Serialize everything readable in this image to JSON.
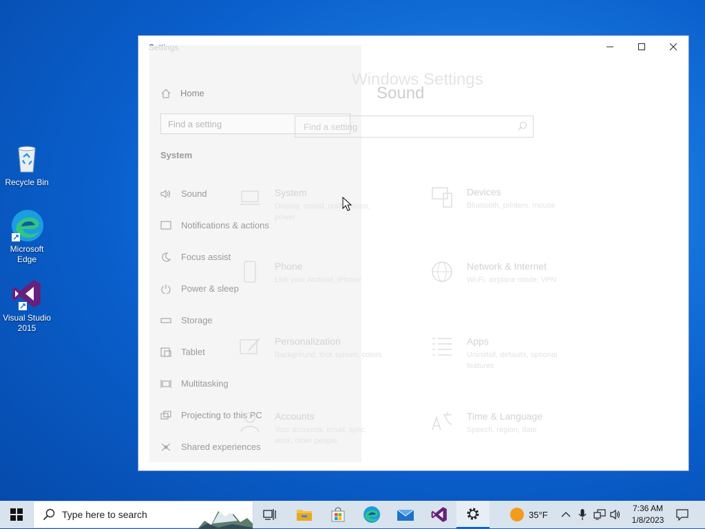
{
  "desktop": {
    "icons": [
      {
        "label": "Recycle Bin"
      },
      {
        "label": "Microsoft Edge"
      },
      {
        "label": "Visual Studio 2015"
      }
    ]
  },
  "window": {
    "title": "Settings",
    "controls": {
      "minimize": "minimize-icon",
      "maximize": "maximize-icon",
      "close": "close-icon"
    }
  },
  "nav": {
    "home": "Home",
    "search_placeholder": "Find a setting",
    "section": "System",
    "items": [
      {
        "label": "Sound",
        "icon": "speaker-icon"
      },
      {
        "label": "Notifications & actions",
        "icon": "notification-icon"
      },
      {
        "label": "Focus assist",
        "icon": "moon-icon"
      },
      {
        "label": "Power & sleep",
        "icon": "power-icon"
      },
      {
        "label": "Storage",
        "icon": "storage-icon"
      },
      {
        "label": "Tablet",
        "icon": "tablet-icon"
      },
      {
        "label": "Multitasking",
        "icon": "multitasking-icon"
      },
      {
        "label": "Projecting to this PC",
        "icon": "projecting-icon"
      },
      {
        "label": "Shared experiences",
        "icon": "shared-icon"
      }
    ]
  },
  "overlay": {
    "windows_settings_title": "Windows Settings",
    "sound_title": "Sound",
    "search_placeholder": "Find a setting",
    "tiles": [
      {
        "name": "System",
        "desc": "Display, sound, notifications, power",
        "icon": "laptop-icon"
      },
      {
        "name": "Devices",
        "desc": "Bluetooth, printers, mouse",
        "icon": "devices-icon"
      },
      {
        "name": "Phone",
        "desc": "Link your Android, iPhone",
        "icon": "phone-icon"
      },
      {
        "name": "Network & Internet",
        "desc": "Wi-Fi, airplane mode, VPN",
        "icon": "globe-icon"
      },
      {
        "name": "Personalization",
        "desc": "Background, lock screen, colors",
        "icon": "personalization-icon"
      },
      {
        "name": "Apps",
        "desc": "Uninstall, defaults, optional features",
        "icon": "apps-icon"
      },
      {
        "name": "Accounts",
        "desc": "Your accounts, email, sync, work, other people",
        "icon": "accounts-icon"
      },
      {
        "name": "Time & Language",
        "desc": "Speech, region, date",
        "icon": "time-language-icon"
      }
    ]
  },
  "taskbar": {
    "search_placeholder": "Type here to search",
    "weather_temp": "35°F",
    "time": "7:36 AM",
    "date": "1/8/2023"
  }
}
